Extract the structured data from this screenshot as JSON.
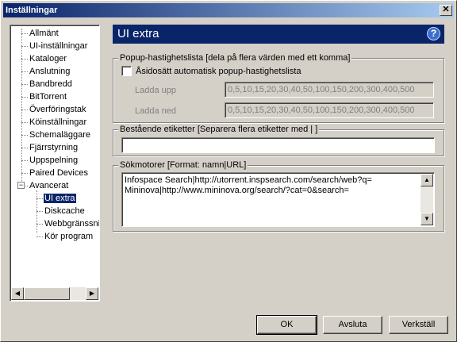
{
  "window": {
    "title": "Inställningar"
  },
  "tree": {
    "items": [
      {
        "label": "Allmänt"
      },
      {
        "label": "UI-inställningar"
      },
      {
        "label": "Kataloger"
      },
      {
        "label": "Anslutning"
      },
      {
        "label": "Bandbredd"
      },
      {
        "label": "BitTorrent"
      },
      {
        "label": "Överföringstak"
      },
      {
        "label": "Köinställningar"
      },
      {
        "label": "Schemaläggare"
      },
      {
        "label": "Fjärrstyrning"
      },
      {
        "label": "Uppspelning"
      },
      {
        "label": "Paired Devices"
      },
      {
        "label": "Avancerat",
        "expander": "−"
      },
      {
        "label": "UI extra",
        "selected": true
      },
      {
        "label": "Diskcache"
      },
      {
        "label": "Webbgränssnitt"
      },
      {
        "label": "Kör program"
      }
    ]
  },
  "header": {
    "title": "UI extra",
    "help_icon": "?"
  },
  "popup": {
    "legend": "Popup-hastighetslista [dela på flera värden med ett komma]",
    "override_label": "Åsidosätt automatisk popup-hastighetslista",
    "override_checked": false,
    "upload_label": "Ladda upp",
    "upload_value": "0,5,10,15,20,30,40,50,100,150,200,300,400,500",
    "download_label": "Ladda ned",
    "download_value": "0,5,10,15,20,30,40,50,100,150,200,300,400,500"
  },
  "labels": {
    "legend": "Bestående etiketter [Separera flera etiketter med | ]",
    "value": ""
  },
  "search": {
    "legend": "Sökmotorer [Format: namn|URL]",
    "lines": [
      "Infospace Search|http://utorrent.inspsearch.com/search/web?q=",
      "Mininova|http://www.mininova.org/search/?cat=0&search="
    ]
  },
  "buttons": {
    "ok": "OK",
    "cancel": "Avsluta",
    "apply": "Verkställ"
  },
  "icons": {
    "close": "✕",
    "scroll_up": "▲",
    "scroll_down": "▼",
    "scroll_left": "◀",
    "scroll_right": "▶"
  }
}
